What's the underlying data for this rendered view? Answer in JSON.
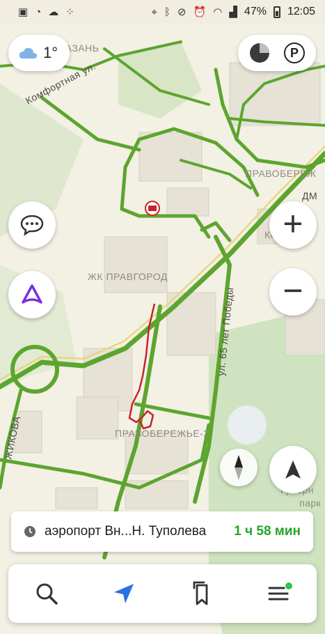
{
  "status_bar": {
    "battery": "47%",
    "time": "12:05"
  },
  "weather": {
    "temperature": "1°",
    "icon": "cloud-icon"
  },
  "map": {
    "labels": {
      "kazan": "КАЗАНЬ",
      "komfortnaya": "Комфортная ул.",
      "pravoberezhny_top": "ПРАВОБЕРЕЖ",
      "dm": "ДМ",
      "kosmos": "КОСМОС",
      "zhk_pravgorod": "ЖК ПРАВГОРОД",
      "pobedy": "ул. 65 лет Победы",
      "pravoberezhye2": "ПРАВОБЕРЕЖЬЕ-2",
      "gubern": "Губерн",
      "park": "парк",
      "zhukova": "ЖИКОВА"
    }
  },
  "controls": {
    "zoom_in": "+",
    "zoom_out": "−",
    "parking": "P"
  },
  "route": {
    "destination": "аэропорт Вн...Н. Туполева",
    "duration": "1 ч 58 мин"
  },
  "bottom_nav": {
    "items": [
      "search-icon",
      "navigation-arrow-icon",
      "bookmarks-icon",
      "menu-icon"
    ]
  },
  "colors": {
    "road_green": "#5ca52e",
    "map_bg": "#f3f0e4",
    "park_green": "#cfe3c0",
    "accent_purple": "#7b2fe0",
    "accent_blue": "#2a6fe6",
    "time_green": "#25a326",
    "track_red": "#c8232c"
  }
}
